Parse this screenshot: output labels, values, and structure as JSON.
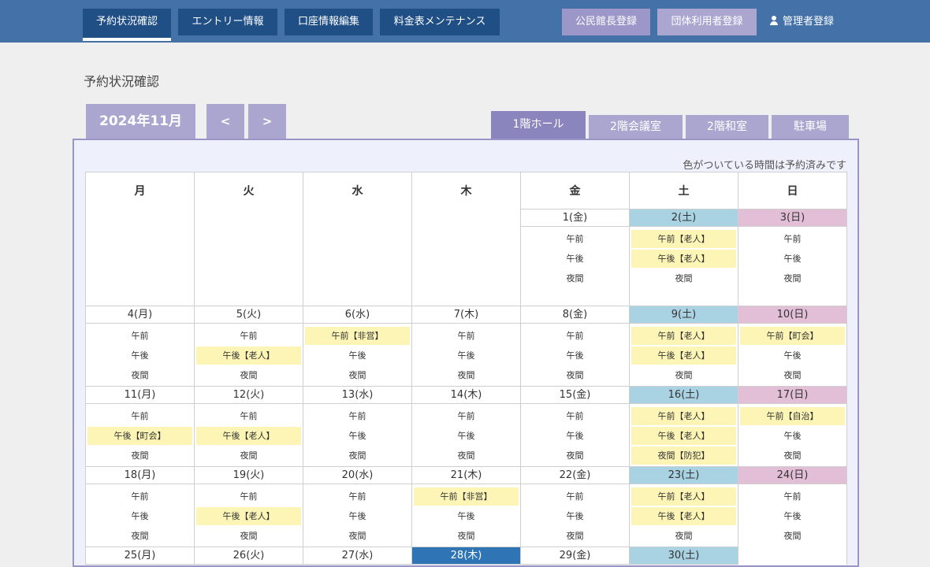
{
  "nav": {
    "items": [
      {
        "label": "予約状況確認",
        "active": true
      },
      {
        "label": "エントリー情報",
        "active": false
      },
      {
        "label": "口座情報編集",
        "active": false
      },
      {
        "label": "料金表メンテナンス",
        "active": false
      }
    ],
    "register_community_center": "公民館長登録",
    "register_group_user": "団体利用者登録",
    "register_admin": "管理者登録"
  },
  "page": {
    "title": "予約状況確認",
    "month": "2024年11月",
    "prev": "<",
    "next": ">",
    "note": "色がついている時間は予約済みです"
  },
  "tabs": [
    {
      "label": "1階ホール",
      "active": true
    },
    {
      "label": "2階会議室",
      "active": false
    },
    {
      "label": "2階和室",
      "active": false
    },
    {
      "label": "駐車場",
      "active": false
    }
  ],
  "weekdays": [
    "月",
    "火",
    "水",
    "木",
    "金",
    "土",
    "日"
  ],
  "weeks": [
    [
      null,
      null,
      null,
      null,
      {
        "date": "1(金)",
        "kind": "",
        "slots": [
          {
            "t": "午前",
            "b": false
          },
          {
            "t": "午後",
            "b": false
          },
          {
            "t": "夜間",
            "b": false
          }
        ]
      },
      {
        "date": "2(土)",
        "kind": "sat",
        "slots": [
          {
            "t": "午前【老人】",
            "b": true
          },
          {
            "t": "午後【老人】",
            "b": true
          },
          {
            "t": "夜間",
            "b": false
          }
        ]
      },
      {
        "date": "3(日)",
        "kind": "sun",
        "slots": [
          {
            "t": "午前",
            "b": false
          },
          {
            "t": "午後",
            "b": false
          },
          {
            "t": "夜間",
            "b": false
          }
        ]
      }
    ],
    [
      {
        "date": "4(月)",
        "kind": "",
        "slots": [
          {
            "t": "午前",
            "b": false
          },
          {
            "t": "午後",
            "b": false
          },
          {
            "t": "夜間",
            "b": false
          }
        ]
      },
      {
        "date": "5(火)",
        "kind": "",
        "slots": [
          {
            "t": "午前",
            "b": false
          },
          {
            "t": "午後【老人】",
            "b": true
          },
          {
            "t": "夜間",
            "b": false
          }
        ]
      },
      {
        "date": "6(水)",
        "kind": "",
        "slots": [
          {
            "t": "午前【非営】",
            "b": true
          },
          {
            "t": "午後",
            "b": false
          },
          {
            "t": "夜間",
            "b": false
          }
        ]
      },
      {
        "date": "7(木)",
        "kind": "",
        "slots": [
          {
            "t": "午前",
            "b": false
          },
          {
            "t": "午後",
            "b": false
          },
          {
            "t": "夜間",
            "b": false
          }
        ]
      },
      {
        "date": "8(金)",
        "kind": "",
        "slots": [
          {
            "t": "午前",
            "b": false
          },
          {
            "t": "午後",
            "b": false
          },
          {
            "t": "夜間",
            "b": false
          }
        ]
      },
      {
        "date": "9(土)",
        "kind": "sat",
        "slots": [
          {
            "t": "午前【老人】",
            "b": true
          },
          {
            "t": "午後【老人】",
            "b": true
          },
          {
            "t": "夜間",
            "b": false
          }
        ]
      },
      {
        "date": "10(日)",
        "kind": "sun",
        "slots": [
          {
            "t": "午前【町会】",
            "b": true
          },
          {
            "t": "午後",
            "b": false
          },
          {
            "t": "夜間",
            "b": false
          }
        ]
      }
    ],
    [
      {
        "date": "11(月)",
        "kind": "",
        "slots": [
          {
            "t": "午前",
            "b": false
          },
          {
            "t": "午後【町会】",
            "b": true
          },
          {
            "t": "夜間",
            "b": false
          }
        ]
      },
      {
        "date": "12(火)",
        "kind": "",
        "slots": [
          {
            "t": "午前",
            "b": false
          },
          {
            "t": "午後【老人】",
            "b": true
          },
          {
            "t": "夜間",
            "b": false
          }
        ]
      },
      {
        "date": "13(水)",
        "kind": "",
        "slots": [
          {
            "t": "午前",
            "b": false
          },
          {
            "t": "午後",
            "b": false
          },
          {
            "t": "夜間",
            "b": false
          }
        ]
      },
      {
        "date": "14(木)",
        "kind": "",
        "slots": [
          {
            "t": "午前",
            "b": false
          },
          {
            "t": "午後",
            "b": false
          },
          {
            "t": "夜間",
            "b": false
          }
        ]
      },
      {
        "date": "15(金)",
        "kind": "",
        "slots": [
          {
            "t": "午前",
            "b": false
          },
          {
            "t": "午後",
            "b": false
          },
          {
            "t": "夜間",
            "b": false
          }
        ]
      },
      {
        "date": "16(土)",
        "kind": "sat",
        "slots": [
          {
            "t": "午前【老人】",
            "b": true
          },
          {
            "t": "午後【老人】",
            "b": true
          },
          {
            "t": "夜間【防犯】",
            "b": true
          }
        ]
      },
      {
        "date": "17(日)",
        "kind": "sun",
        "slots": [
          {
            "t": "午前【自治】",
            "b": true
          },
          {
            "t": "午後",
            "b": false
          },
          {
            "t": "夜間",
            "b": false
          }
        ]
      }
    ],
    [
      {
        "date": "18(月)",
        "kind": "",
        "slots": [
          {
            "t": "午前",
            "b": false
          },
          {
            "t": "午後",
            "b": false
          },
          {
            "t": "夜間",
            "b": false
          }
        ]
      },
      {
        "date": "19(火)",
        "kind": "",
        "slots": [
          {
            "t": "午前",
            "b": false
          },
          {
            "t": "午後【老人】",
            "b": true
          },
          {
            "t": "夜間",
            "b": false
          }
        ]
      },
      {
        "date": "20(水)",
        "kind": "",
        "slots": [
          {
            "t": "午前",
            "b": false
          },
          {
            "t": "午後",
            "b": false
          },
          {
            "t": "夜間",
            "b": false
          }
        ]
      },
      {
        "date": "21(木)",
        "kind": "",
        "slots": [
          {
            "t": "午前【非営】",
            "b": true
          },
          {
            "t": "午後",
            "b": false
          },
          {
            "t": "夜間",
            "b": false
          }
        ]
      },
      {
        "date": "22(金)",
        "kind": "",
        "slots": [
          {
            "t": "午前",
            "b": false
          },
          {
            "t": "午後",
            "b": false
          },
          {
            "t": "夜間",
            "b": false
          }
        ]
      },
      {
        "date": "23(土)",
        "kind": "sat",
        "slots": [
          {
            "t": "午前【老人】",
            "b": true
          },
          {
            "t": "午後【老人】",
            "b": true
          },
          {
            "t": "夜間",
            "b": false
          }
        ]
      },
      {
        "date": "24(日)",
        "kind": "sun",
        "slots": [
          {
            "t": "午前",
            "b": false
          },
          {
            "t": "午後",
            "b": false
          },
          {
            "t": "夜間",
            "b": false
          }
        ]
      }
    ],
    [
      {
        "date": "25(月)",
        "kind": "",
        "slots": []
      },
      {
        "date": "26(火)",
        "kind": "",
        "slots": []
      },
      {
        "date": "27(水)",
        "kind": "",
        "slots": []
      },
      {
        "date": "28(木)",
        "kind": "today",
        "slots": []
      },
      {
        "date": "29(金)",
        "kind": "",
        "slots": []
      },
      {
        "date": "30(土)",
        "kind": "sat",
        "slots": []
      },
      null
    ]
  ],
  "colors": {
    "header": "#4472a8",
    "nav_button": "#1f4f85",
    "accent": "#aaa6d0",
    "saturday": "#a9d2e3",
    "sunday": "#e2bfd6",
    "today": "#2f74b5",
    "booked": "#fdf5b6"
  }
}
